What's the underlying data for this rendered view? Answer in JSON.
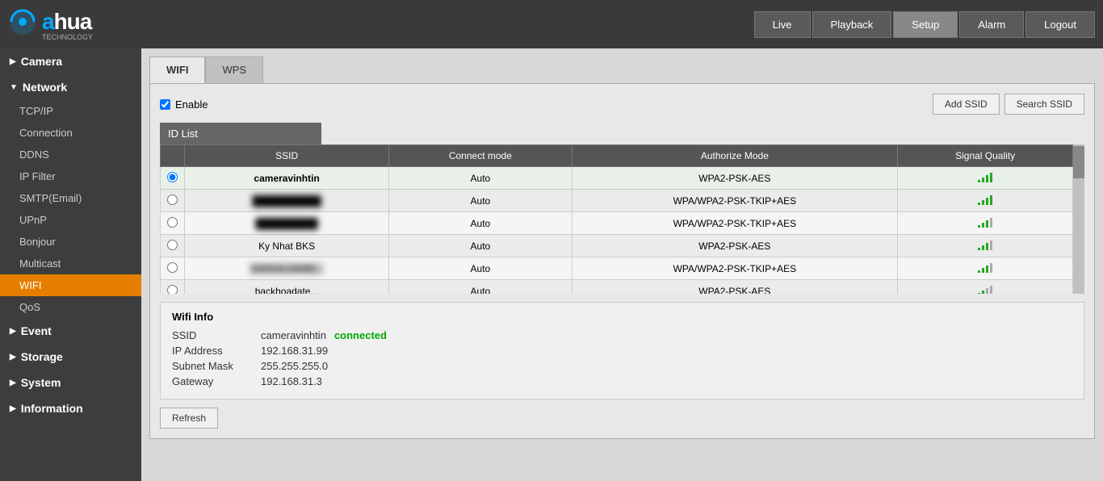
{
  "header": {
    "logo": "alhua",
    "logo_sub": "TECHNOLOGY",
    "nav": [
      {
        "label": "Live",
        "active": false
      },
      {
        "label": "Playback",
        "active": false
      },
      {
        "label": "Setup",
        "active": true
      },
      {
        "label": "Alarm",
        "active": false
      },
      {
        "label": "Logout",
        "active": false
      }
    ]
  },
  "sidebar": {
    "sections": [
      {
        "label": "Camera",
        "expanded": false,
        "items": []
      },
      {
        "label": "Network",
        "expanded": true,
        "items": [
          {
            "label": "TCP/IP",
            "active": false
          },
          {
            "label": "Connection",
            "active": false
          },
          {
            "label": "DDNS",
            "active": false
          },
          {
            "label": "IP Filter",
            "active": false
          },
          {
            "label": "SMTP(Email)",
            "active": false
          },
          {
            "label": "UPnP",
            "active": false
          },
          {
            "label": "Bonjour",
            "active": false
          },
          {
            "label": "Multicast",
            "active": false
          },
          {
            "label": "WIFI",
            "active": true
          },
          {
            "label": "QoS",
            "active": false
          }
        ]
      },
      {
        "label": "Event",
        "expanded": false,
        "items": []
      },
      {
        "label": "Storage",
        "expanded": false,
        "items": []
      },
      {
        "label": "System",
        "expanded": false,
        "items": []
      },
      {
        "label": "Information",
        "expanded": false,
        "items": []
      }
    ]
  },
  "tabs": [
    {
      "label": "WIFI",
      "active": true
    },
    {
      "label": "WPS",
      "active": false
    }
  ],
  "enable": {
    "label": "Enable",
    "checked": true
  },
  "buttons": {
    "add_ssid": "Add SSID",
    "search_ssid": "Search SSID",
    "refresh": "Refresh"
  },
  "table": {
    "id_list_header": "ID List",
    "columns": [
      "SSID",
      "Connect mode",
      "Authorize Mode",
      "Signal Quality"
    ],
    "rows": [
      {
        "ssid": "cameravinhtin",
        "blurred": false,
        "mode": "Auto",
        "auth": "WPA2-PSK-AES",
        "signal": 4,
        "selected": true
      },
      {
        "ssid": "██████████",
        "blurred": true,
        "mode": "Auto",
        "auth": "WPA/WPA2-PSK-TKIP+AES",
        "signal": 4,
        "selected": false
      },
      {
        "ssid": "█████████",
        "blurred": true,
        "mode": "Auto",
        "auth": "WPA/WPA2-PSK-TKIP+AES",
        "signal": 3,
        "selected": false
      },
      {
        "ssid": "Ky Nhat BKS",
        "blurred": false,
        "mode": "Auto",
        "auth": "WPA2-PSK-AES",
        "signal": 3,
        "selected": false
      },
      {
        "ssid": "DAHUA-04494...",
        "blurred": true,
        "mode": "Auto",
        "auth": "WPA/WPA2-PSK-TKIP+AES",
        "signal": 3,
        "selected": false
      },
      {
        "ssid": "backhoadate...",
        "blurred": false,
        "mode": "Auto",
        "auth": "WPA2-PSK-AES",
        "signal": 2,
        "selected": false
      }
    ]
  },
  "wifi_info": {
    "title": "Wifi Info",
    "ssid_label": "SSID",
    "ssid_value": "cameravinhtin",
    "connected": "connected",
    "ip_label": "IP Address",
    "ip_value": "192.168.31.99",
    "subnet_label": "Subnet Mask",
    "subnet_value": "255.255.255.0",
    "gateway_label": "Gateway",
    "gateway_value": "192.168.31.3"
  }
}
